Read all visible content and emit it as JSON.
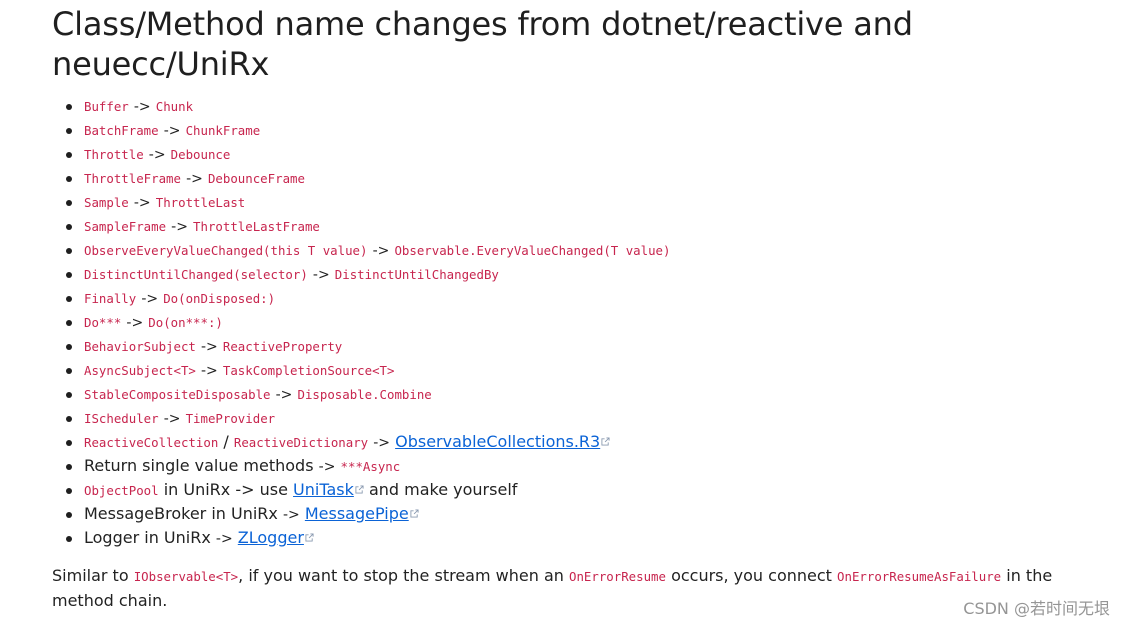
{
  "heading": "Class/Method name changes from dotnet/reactive and neuecc/UniRx",
  "items": [
    {
      "from": "Buffer",
      "arrow": "->",
      "to": "Chunk"
    },
    {
      "from": "BatchFrame",
      "arrow": "->",
      "to": "ChunkFrame"
    },
    {
      "from": "Throttle",
      "arrow": "->",
      "to": "Debounce"
    },
    {
      "from": "ThrottleFrame",
      "arrow": "->",
      "to": "DebounceFrame"
    },
    {
      "from": "Sample",
      "arrow": "->",
      "to": "ThrottleLast"
    },
    {
      "from": "SampleFrame",
      "arrow": "->",
      "to": "ThrottleLastFrame"
    },
    {
      "from": "ObserveEveryValueChanged(this T value)",
      "arrow": "->",
      "to": "Observable.EveryValueChanged(T value)"
    },
    {
      "from": "DistinctUntilChanged(selector)",
      "arrow": "->",
      "to": "DistinctUntilChangedBy"
    },
    {
      "from": "Finally",
      "arrow": "->",
      "to": "Do(onDisposed:)"
    },
    {
      "from": "Do***",
      "arrow": "->",
      "to": "Do(on***:)"
    },
    {
      "from": "BehaviorSubject",
      "arrow": "->",
      "to": "ReactiveProperty"
    },
    {
      "from": "AsyncSubject<T>",
      "arrow": "->",
      "to": "TaskCompletionSource<T>"
    },
    {
      "from": "StableCompositeDisposable",
      "arrow": "->",
      "to": "Disposable.Combine"
    },
    {
      "from": "IScheduler",
      "arrow": "->",
      "to": "TimeProvider"
    }
  ],
  "collections_item": {
    "code1": "ReactiveCollection",
    "slash": "/",
    "code2": "ReactiveDictionary",
    "arrow": "->",
    "link": "ObservableCollections.R3"
  },
  "return_item": {
    "text": "Return single value methods",
    "arrow": "->",
    "code": "***Async"
  },
  "objectpool_item": {
    "code": "ObjectPool",
    "text_before": "in UniRx -> use",
    "link": "UniTask",
    "text_after": "and make yourself"
  },
  "messagebroker_item": {
    "text": "MessageBroker in UniRx",
    "arrow": "->",
    "link": "MessagePipe"
  },
  "logger_item": {
    "text": "Logger in UniRx",
    "arrow": "->",
    "link": "ZLogger"
  },
  "note": {
    "part1": "Similar to",
    "code1": "IObservable<T>",
    "part2": ", if you want to stop the stream when an",
    "code2": "OnErrorResume",
    "part3": "occurs, you connect",
    "code3": "OnErrorResumeAsFailure",
    "part4": "in the method chain."
  },
  "watermark": "CSDN @若时间无垠",
  "colors": {
    "code": "#c7254e",
    "link": "#0b63d6",
    "text": "#222222"
  },
  "icons": {
    "external_link": "external-link-icon"
  }
}
